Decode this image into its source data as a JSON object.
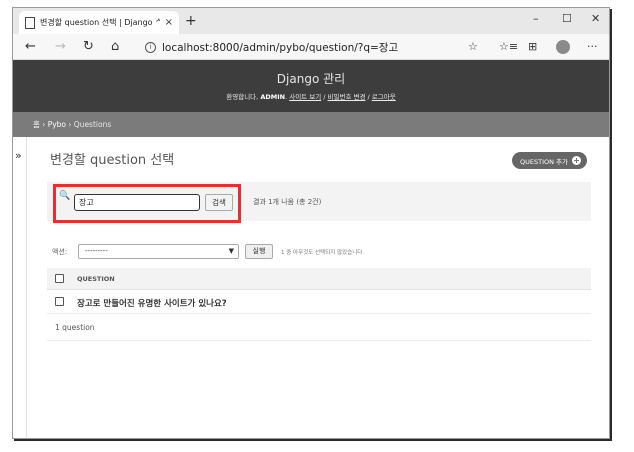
{
  "browser": {
    "tab_title": "변경할 question 선택 | Django ᄉ",
    "tab_close": "×",
    "new_tab": "+",
    "minimize": "–",
    "maximize": "☐",
    "close": "✕",
    "back": "←",
    "forward": "→",
    "reload": "↻",
    "home": "⌂",
    "info": "i",
    "url": "localhost:8000/admin/pybo/question/?q=장고",
    "favorite": "☆",
    "favorites_bar": "☆≡",
    "collections": "⊞",
    "more": "···"
  },
  "header": {
    "brand": "Django 관리",
    "welcome": "환영합니다, ",
    "user": "ADMIN",
    "period": ". ",
    "view_site": "사이트 보기",
    "sep1": " / ",
    "change_password": "비밀번호 변경",
    "sep2": " / ",
    "logout": "로그아웃"
  },
  "breadcrumbs": {
    "home": "홈",
    "sep1": " › ",
    "app": "Pybo",
    "sep2": " › ",
    "current": "Questions"
  },
  "sidebar": {
    "toggle": "»"
  },
  "main": {
    "title": "변경할 question 선택",
    "add_button": "QUESTION 추가",
    "add_icon": "+"
  },
  "search": {
    "icon": "🔍",
    "value": "장고",
    "button": "검색",
    "result": "결과 1개 나옴 (총 2건)"
  },
  "actions": {
    "label": "액션:",
    "selected": "---------",
    "run": "실행",
    "note": "1 중 아무것도 선택되지 않았습니다."
  },
  "table": {
    "column": "QUESTION",
    "rows": [
      {
        "subject": "장고로 만들어진 유명한 사이트가 있나요?"
      }
    ]
  },
  "paginator": {
    "text": "1 question"
  },
  "colors": {
    "highlight": "#e8302a",
    "header": "#3d3d3d",
    "breadcrumbs": "#7b7b7b"
  }
}
